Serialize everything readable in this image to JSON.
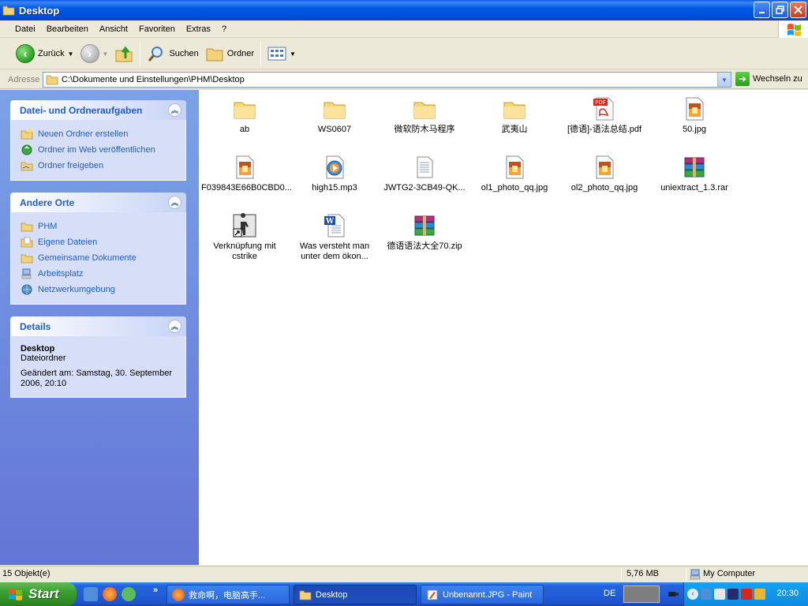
{
  "window": {
    "title": "Desktop"
  },
  "menu": [
    "Datei",
    "Bearbeiten",
    "Ansicht",
    "Favoriten",
    "Extras",
    "?"
  ],
  "toolbar": {
    "back_label": "Zurück",
    "search_label": "Suchen",
    "folders_label": "Ordner"
  },
  "address": {
    "label": "Adresse",
    "path": "C:\\Dokumente und Einstellungen\\PHM\\Desktop",
    "go_label": "Wechseln zu"
  },
  "tasks": {
    "title": "Datei- und Ordneraufgaben",
    "items": [
      "Neuen Ordner erstellen",
      "Ordner im Web veröffentlichen",
      "Ordner freigeben"
    ]
  },
  "places": {
    "title": "Andere Orte",
    "items": [
      "PHM",
      "Eigene Dateien",
      "Gemeinsame Dokumente",
      "Arbeitsplatz",
      "Netzwerkumgebung"
    ]
  },
  "details": {
    "title": "Details",
    "name": "Desktop",
    "type": "Dateiordner",
    "modified": "Geändert am: Samstag, 30. September 2006, 20:10"
  },
  "files": [
    {
      "name": "ab",
      "icon": "folder-icon"
    },
    {
      "name": "WS0607",
      "icon": "folder-icon"
    },
    {
      "name": "微软防木马程序",
      "icon": "folder-icon"
    },
    {
      "name": "武夷山",
      "icon": "folder-icon"
    },
    {
      "name": "[德语]-语法总结.pdf",
      "icon": "pdf-icon"
    },
    {
      "name": "50.jpg",
      "icon": "image-icon"
    },
    {
      "name": "F039843E66B0CBD0...",
      "icon": "image-icon"
    },
    {
      "name": "high15.mp3",
      "icon": "media-icon"
    },
    {
      "name": "JWTG2-3CB49-QK...",
      "icon": "text-file-icon"
    },
    {
      "name": "ol1_photo_qq.jpg",
      "icon": "image-icon"
    },
    {
      "name": "ol2_photo_qq.jpg",
      "icon": "image-icon"
    },
    {
      "name": "uniextract_1.3.rar",
      "icon": "archive-icon"
    },
    {
      "name": "Verknüpfung mit cstrike",
      "icon": "shortcut-icon"
    },
    {
      "name": "Was versteht man unter dem ökon...",
      "icon": "word-doc-icon"
    },
    {
      "name": "德语语法大全70.zip",
      "icon": "archive-icon"
    }
  ],
  "status": {
    "count": "15 Objekt(e)",
    "size": "5,76 MB",
    "location": "My Computer"
  },
  "taskbar": {
    "start_label": "Start",
    "more": "»",
    "buttons": [
      {
        "label": "救命啊，电脑高手..."
      },
      {
        "label": "Desktop"
      },
      {
        "label": "Unbenannt.JPG - Paint"
      }
    ],
    "lang": "DE",
    "clock": "20:30"
  }
}
